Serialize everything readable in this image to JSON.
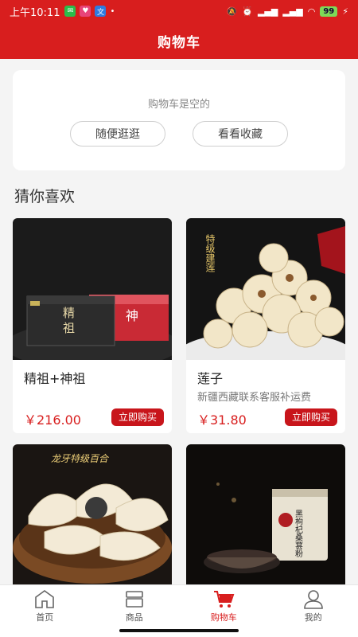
{
  "status_bar": {
    "time": "上午10:11",
    "battery": "99"
  },
  "header": {
    "title": "购物车"
  },
  "cart": {
    "empty_text": "购物车是空的",
    "browse_label": "随便逛逛",
    "favorites_label": "看看收藏"
  },
  "recommend": {
    "title": "猜你喜欢",
    "products": [
      {
        "name": "精祖+神祖",
        "desc": "",
        "price": "￥216.00",
        "buy_label": "立即购买"
      },
      {
        "name": "莲子",
        "desc": "新疆西藏联系客服补运费",
        "price": "￥31.80",
        "buy_label": "立即购买"
      },
      {
        "name": "",
        "desc": "",
        "price": "",
        "buy_label": ""
      },
      {
        "name": "",
        "desc": "",
        "price": "",
        "buy_label": ""
      }
    ],
    "image_text": {
      "p2": "特级建莲",
      "p3": "龙牙特级百合",
      "p4": "黑枸杞桑葚粉"
    }
  },
  "tabbar": {
    "home": "首页",
    "goods": "商品",
    "cart": "购物车",
    "mine": "我的"
  },
  "colors": {
    "brand": "#d81e1e",
    "active_tab": "#d81e1e"
  }
}
